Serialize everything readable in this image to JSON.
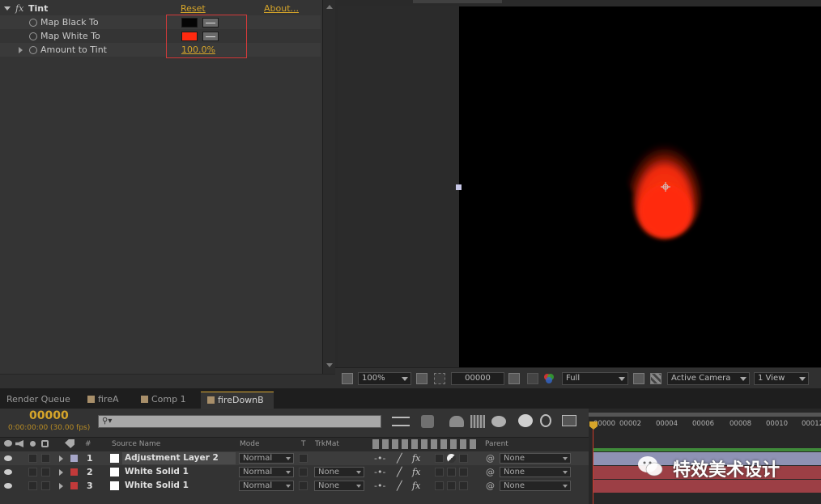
{
  "effect": {
    "name": "Tint",
    "reset": "Reset",
    "about": "About...",
    "params": [
      {
        "label": "Map Black To",
        "color": "#050505"
      },
      {
        "label": "Map White To",
        "color": "#ff2a10"
      },
      {
        "label": "Amount to Tint",
        "value": "100.0%"
      }
    ]
  },
  "viewer": {
    "zoom": "100%",
    "timecode": "00000",
    "resolution": "Full",
    "camera": "Active Camera",
    "views": "1 View"
  },
  "tabs": [
    {
      "label": "Render Queue"
    },
    {
      "label": "fireA"
    },
    {
      "label": "Comp 1"
    },
    {
      "label": "fireDownB",
      "close": "×"
    }
  ],
  "timeline": {
    "current_time": "00000",
    "time_sub": "0:00:00:00 (30.00 fps)",
    "search_placeholder": "⚲▾",
    "ruler": [
      "00000",
      "00002",
      "00004",
      "00006",
      "00008",
      "00010",
      "00012"
    ],
    "headers": {
      "hash": "#",
      "source_name": "Source Name",
      "mode": "Mode",
      "t": "T",
      "trkmat": "TrkMat",
      "parent": "Parent"
    },
    "layers": [
      {
        "num": "1",
        "name": "Adjustment Layer 2",
        "mode": "Normal",
        "trkmat": "",
        "parent": "None",
        "label_color": "#a6a6c8",
        "bar_color": "#8e92b4"
      },
      {
        "num": "2",
        "name": "White Solid 1",
        "mode": "Normal",
        "trkmat": "None",
        "parent": "None",
        "label_color": "#c23a3a",
        "bar_color": "#9c3f45"
      },
      {
        "num": "3",
        "name": "White Solid 1",
        "mode": "Normal",
        "trkmat": "None",
        "parent": "None",
        "label_color": "#c23a3a",
        "bar_color": "#9c3f45"
      }
    ]
  },
  "watermark": "特效美术设计",
  "accent": "#d6a52a"
}
